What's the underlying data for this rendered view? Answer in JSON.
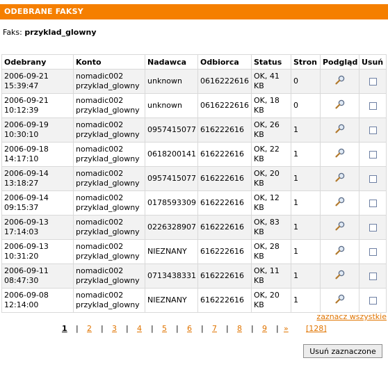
{
  "header": {
    "title": "ODEBRANE FAKSY"
  },
  "fax_info": {
    "label": "Faks:",
    "value": "przyklad_glowny"
  },
  "table": {
    "columns": [
      "Odebrany",
      "Konto",
      "Nadawca",
      "Odbiorca",
      "Status",
      "Stron",
      "Podgląd",
      "Usuń"
    ],
    "rows": [
      {
        "date": "2006-09-21",
        "time": "15:39:47",
        "account": "nomadic002",
        "subaccount": "przyklad_glowny",
        "sender": "unknown",
        "recipient": "0616222616",
        "status": "OK, 41",
        "size": "KB",
        "pages": "0"
      },
      {
        "date": "2006-09-21",
        "time": "10:12:39",
        "account": "nomadic002",
        "subaccount": "przyklad_glowny",
        "sender": "unknown",
        "recipient": "0616222616",
        "status": "OK, 18",
        "size": "KB",
        "pages": "0"
      },
      {
        "date": "2006-09-19",
        "time": "10:30:10",
        "account": "nomadic002",
        "subaccount": "przyklad_glowny",
        "sender": "0957415077",
        "recipient": "616222616",
        "status": "OK, 26",
        "size": "KB",
        "pages": "1"
      },
      {
        "date": "2006-09-18",
        "time": "14:17:10",
        "account": "nomadic002",
        "subaccount": "przyklad_glowny",
        "sender": "0618200141",
        "recipient": "616222616",
        "status": "OK, 22",
        "size": "KB",
        "pages": "1"
      },
      {
        "date": "2006-09-14",
        "time": "13:18:27",
        "account": "nomadic002",
        "subaccount": "przyklad_glowny",
        "sender": "0957415077",
        "recipient": "616222616",
        "status": "OK, 20",
        "size": "KB",
        "pages": "1"
      },
      {
        "date": "2006-09-14",
        "time": "09:15:37",
        "account": "nomadic002",
        "subaccount": "przyklad_glowny",
        "sender": "0178593309",
        "recipient": "616222616",
        "status": "OK, 12",
        "size": "KB",
        "pages": "1"
      },
      {
        "date": "2006-09-13",
        "time": "17:14:03",
        "account": "nomadic002",
        "subaccount": "przyklad_glowny",
        "sender": "0226328907",
        "recipient": "616222616",
        "status": "OK, 83",
        "size": "KB",
        "pages": "1"
      },
      {
        "date": "2006-09-13",
        "time": "10:31:20",
        "account": "nomadic002",
        "subaccount": "przyklad_glowny",
        "sender": "NIEZNANY",
        "recipient": "616222616",
        "status": "OK, 28",
        "size": "KB",
        "pages": "1"
      },
      {
        "date": "2006-09-11",
        "time": "08:47:30",
        "account": "nomadic002",
        "subaccount": "przyklad_glowny",
        "sender": "0713438331",
        "recipient": "616222616",
        "status": "OK, 11",
        "size": "KB",
        "pages": "1"
      },
      {
        "date": "2006-09-08",
        "time": "12:14:00",
        "account": "nomadic002",
        "subaccount": "przyklad_glowny",
        "sender": "NIEZNANY",
        "recipient": "616222616",
        "status": "OK, 20",
        "size": "KB",
        "pages": "1"
      }
    ],
    "preview_icon": "magnifier-icon"
  },
  "select_all": {
    "label": "zaznacz wszystkie"
  },
  "pager": {
    "current": "1",
    "pages": [
      "2",
      "3",
      "4",
      "5",
      "6",
      "7",
      "8",
      "9"
    ],
    "separator": "|",
    "next": "»",
    "last": "[128]"
  },
  "actions": {
    "delete_selected": "Usuń zaznaczone"
  },
  "colors": {
    "header_bg": "#f57f00",
    "link": "#e07400"
  }
}
